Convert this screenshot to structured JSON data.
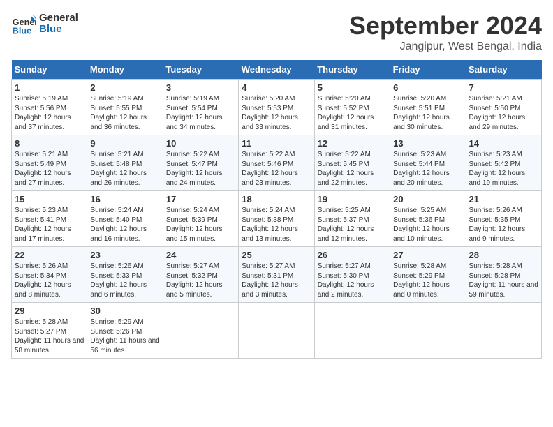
{
  "header": {
    "logo_line1": "General",
    "logo_line2": "Blue",
    "month_title": "September 2024",
    "location": "Jangipur, West Bengal, India"
  },
  "columns": [
    "Sunday",
    "Monday",
    "Tuesday",
    "Wednesday",
    "Thursday",
    "Friday",
    "Saturday"
  ],
  "weeks": [
    [
      {
        "day": "1",
        "sunrise": "5:19 AM",
        "sunset": "5:56 PM",
        "daylight": "12 hours and 37 minutes."
      },
      {
        "day": "2",
        "sunrise": "5:19 AM",
        "sunset": "5:55 PM",
        "daylight": "12 hours and 36 minutes."
      },
      {
        "day": "3",
        "sunrise": "5:19 AM",
        "sunset": "5:54 PM",
        "daylight": "12 hours and 34 minutes."
      },
      {
        "day": "4",
        "sunrise": "5:20 AM",
        "sunset": "5:53 PM",
        "daylight": "12 hours and 33 minutes."
      },
      {
        "day": "5",
        "sunrise": "5:20 AM",
        "sunset": "5:52 PM",
        "daylight": "12 hours and 31 minutes."
      },
      {
        "day": "6",
        "sunrise": "5:20 AM",
        "sunset": "5:51 PM",
        "daylight": "12 hours and 30 minutes."
      },
      {
        "day": "7",
        "sunrise": "5:21 AM",
        "sunset": "5:50 PM",
        "daylight": "12 hours and 29 minutes."
      }
    ],
    [
      {
        "day": "8",
        "sunrise": "5:21 AM",
        "sunset": "5:49 PM",
        "daylight": "12 hours and 27 minutes."
      },
      {
        "day": "9",
        "sunrise": "5:21 AM",
        "sunset": "5:48 PM",
        "daylight": "12 hours and 26 minutes."
      },
      {
        "day": "10",
        "sunrise": "5:22 AM",
        "sunset": "5:47 PM",
        "daylight": "12 hours and 24 minutes."
      },
      {
        "day": "11",
        "sunrise": "5:22 AM",
        "sunset": "5:46 PM",
        "daylight": "12 hours and 23 minutes."
      },
      {
        "day": "12",
        "sunrise": "5:22 AM",
        "sunset": "5:45 PM",
        "daylight": "12 hours and 22 minutes."
      },
      {
        "day": "13",
        "sunrise": "5:23 AM",
        "sunset": "5:44 PM",
        "daylight": "12 hours and 20 minutes."
      },
      {
        "day": "14",
        "sunrise": "5:23 AM",
        "sunset": "5:42 PM",
        "daylight": "12 hours and 19 minutes."
      }
    ],
    [
      {
        "day": "15",
        "sunrise": "5:23 AM",
        "sunset": "5:41 PM",
        "daylight": "12 hours and 17 minutes."
      },
      {
        "day": "16",
        "sunrise": "5:24 AM",
        "sunset": "5:40 PM",
        "daylight": "12 hours and 16 minutes."
      },
      {
        "day": "17",
        "sunrise": "5:24 AM",
        "sunset": "5:39 PM",
        "daylight": "12 hours and 15 minutes."
      },
      {
        "day": "18",
        "sunrise": "5:24 AM",
        "sunset": "5:38 PM",
        "daylight": "12 hours and 13 minutes."
      },
      {
        "day": "19",
        "sunrise": "5:25 AM",
        "sunset": "5:37 PM",
        "daylight": "12 hours and 12 minutes."
      },
      {
        "day": "20",
        "sunrise": "5:25 AM",
        "sunset": "5:36 PM",
        "daylight": "12 hours and 10 minutes."
      },
      {
        "day": "21",
        "sunrise": "5:26 AM",
        "sunset": "5:35 PM",
        "daylight": "12 hours and 9 minutes."
      }
    ],
    [
      {
        "day": "22",
        "sunrise": "5:26 AM",
        "sunset": "5:34 PM",
        "daylight": "12 hours and 8 minutes."
      },
      {
        "day": "23",
        "sunrise": "5:26 AM",
        "sunset": "5:33 PM",
        "daylight": "12 hours and 6 minutes."
      },
      {
        "day": "24",
        "sunrise": "5:27 AM",
        "sunset": "5:32 PM",
        "daylight": "12 hours and 5 minutes."
      },
      {
        "day": "25",
        "sunrise": "5:27 AM",
        "sunset": "5:31 PM",
        "daylight": "12 hours and 3 minutes."
      },
      {
        "day": "26",
        "sunrise": "5:27 AM",
        "sunset": "5:30 PM",
        "daylight": "12 hours and 2 minutes."
      },
      {
        "day": "27",
        "sunrise": "5:28 AM",
        "sunset": "5:29 PM",
        "daylight": "12 hours and 0 minutes."
      },
      {
        "day": "28",
        "sunrise": "5:28 AM",
        "sunset": "5:28 PM",
        "daylight": "11 hours and 59 minutes."
      }
    ],
    [
      {
        "day": "29",
        "sunrise": "5:28 AM",
        "sunset": "5:27 PM",
        "daylight": "11 hours and 58 minutes."
      },
      {
        "day": "30",
        "sunrise": "5:29 AM",
        "sunset": "5:26 PM",
        "daylight": "11 hours and 56 minutes."
      },
      null,
      null,
      null,
      null,
      null
    ]
  ]
}
